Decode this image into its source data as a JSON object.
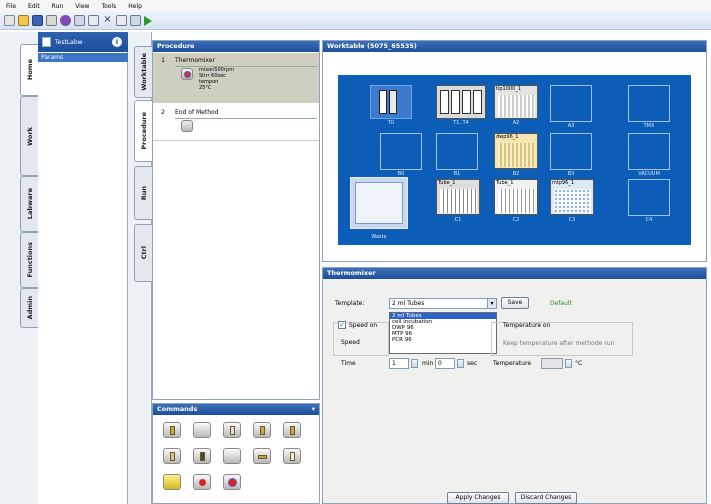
{
  "menu": [
    "File",
    "Edit",
    "Run",
    "View",
    "Tools",
    "Help"
  ],
  "left_tabs": [
    "Home",
    "Work",
    "Labware",
    "Functions",
    "Admin"
  ],
  "method_panel": {
    "title": "TestLabw",
    "selected": "Params"
  },
  "middle_tabs": [
    "Worktable",
    "Procedure",
    "Run",
    "Ctrl"
  ],
  "procedure": {
    "title": "Procedure",
    "steps": [
      {
        "num": "1",
        "title": "Thermomixer",
        "details": [
          "mixon500rpm",
          "Stirr 60sec",
          "tempon",
          "25°C"
        ]
      },
      {
        "num": "2",
        "title": "End of Method",
        "details": []
      }
    ]
  },
  "commands": {
    "title": "Commands"
  },
  "worktable": {
    "title": "Worktable (5075_65535)",
    "slots": [
      {
        "label": "T0"
      },
      {
        "label": "T1..T4"
      },
      {
        "label": "A2"
      },
      {
        "label": "A3"
      },
      {
        "label": "TMX"
      },
      {
        "label": "B0"
      },
      {
        "label": "B1"
      },
      {
        "label": "B2"
      },
      {
        "label": "B3"
      },
      {
        "label": "VACUUM"
      },
      {
        "label": "Waste"
      },
      {
        "label": "C1"
      },
      {
        "label": "C2"
      },
      {
        "label": "C3"
      },
      {
        "label": "C4"
      }
    ],
    "labware": [
      {
        "name": "tip1000_1"
      },
      {
        "name": "dwp96_1"
      },
      {
        "name": "Tube_1"
      },
      {
        "name": "Tube_1"
      },
      {
        "name": "mtp96_1"
      }
    ]
  },
  "thermomixer": {
    "title": "Thermomixer",
    "template_label": "Template:",
    "template_value": "2 ml Tubes",
    "template_options": [
      "2 ml Tubes",
      "cell incubation",
      "DWP 96",
      "MTP 96",
      "PCR 96"
    ],
    "save_button": "Save",
    "default_label": "Default",
    "speed_on_label": "Speed on",
    "speed_label": "Speed",
    "time_label": "Time",
    "time_min_value": "1",
    "time_min_unit": "min",
    "time_sec_value": "0",
    "time_sec_unit": "sec",
    "temperature_on_label": "Temperature on",
    "keep_temp_label": "Keep temperature after methode run",
    "temperature_label": "Temperature",
    "temperature_unit": "°C",
    "apply_button": "Apply Changes",
    "discard_button": "Discard Changes"
  },
  "colors": {
    "header_blue": "#1e4f9a",
    "worktable_blue": "#0c5db7",
    "selection_blue": "#2d63c8",
    "default_green": "#2a8a2a"
  }
}
